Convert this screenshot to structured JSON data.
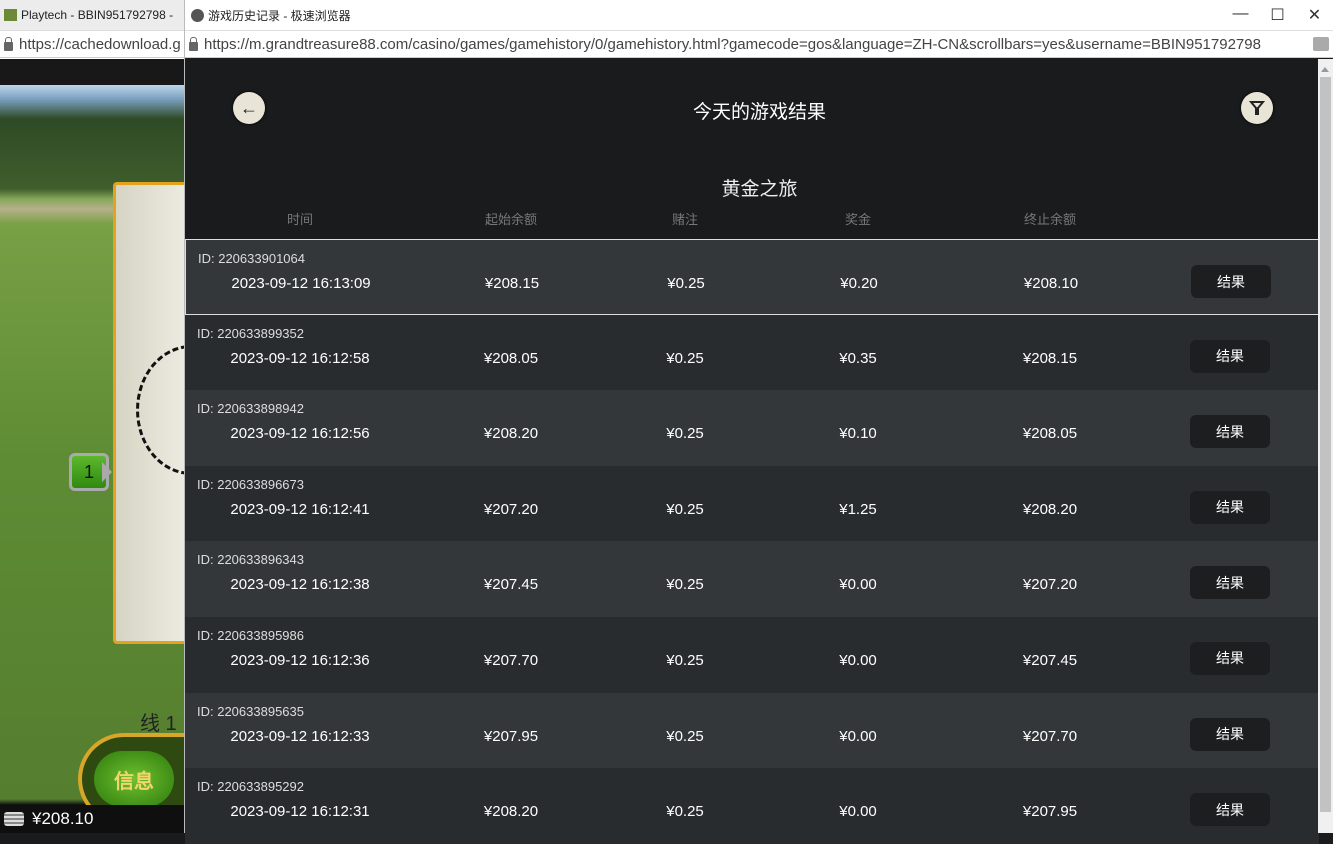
{
  "background_window": {
    "tab_title": "Playtech - BBIN951792798 -",
    "url": "https://cachedownload.g",
    "line_label": "线 1",
    "line_badge": "1",
    "info_button": "信息",
    "balance": "¥208.10"
  },
  "browser": {
    "tab_title": "游戏历史记录 - 极速浏览器",
    "url": "https://m.grandtreasure88.com/casino/games/gamehistory/0/gamehistory.html?gamecode=gos&language=ZH-CN&scrollbars=yes&username=BBIN951792798",
    "minimize": "—",
    "maximize": "☐",
    "close": "✕"
  },
  "page": {
    "title": "今天的游戏结果",
    "game_name": "黄金之旅",
    "back_icon": "arrow-left",
    "filter_icon": "filter",
    "columns": [
      "时间",
      "起始余额",
      "赌注",
      "奖金",
      "终止余额"
    ],
    "result_label": "结果",
    "rows": [
      {
        "id": "ID:  220633901064",
        "time": "2023-09-12  16:13:09",
        "start": "¥208.15",
        "bet": "¥0.25",
        "win": "¥0.20",
        "end": "¥208.10"
      },
      {
        "id": "ID:  220633899352",
        "time": "2023-09-12  16:12:58",
        "start": "¥208.05",
        "bet": "¥0.25",
        "win": "¥0.35",
        "end": "¥208.15"
      },
      {
        "id": "ID:  220633898942",
        "time": "2023-09-12  16:12:56",
        "start": "¥208.20",
        "bet": "¥0.25",
        "win": "¥0.10",
        "end": "¥208.05"
      },
      {
        "id": "ID:  220633896673",
        "time": "2023-09-12  16:12:41",
        "start": "¥207.20",
        "bet": "¥0.25",
        "win": "¥1.25",
        "end": "¥208.20"
      },
      {
        "id": "ID:  220633896343",
        "time": "2023-09-12  16:12:38",
        "start": "¥207.45",
        "bet": "¥0.25",
        "win": "¥0.00",
        "end": "¥207.20"
      },
      {
        "id": "ID:  220633895986",
        "time": "2023-09-12  16:12:36",
        "start": "¥207.70",
        "bet": "¥0.25",
        "win": "¥0.00",
        "end": "¥207.45"
      },
      {
        "id": "ID:  220633895635",
        "time": "2023-09-12  16:12:33",
        "start": "¥207.95",
        "bet": "¥0.25",
        "win": "¥0.00",
        "end": "¥207.70"
      },
      {
        "id": "ID:  220633895292",
        "time": "2023-09-12  16:12:31",
        "start": "¥208.20",
        "bet": "¥0.25",
        "win": "¥0.00",
        "end": "¥207.95"
      }
    ]
  }
}
